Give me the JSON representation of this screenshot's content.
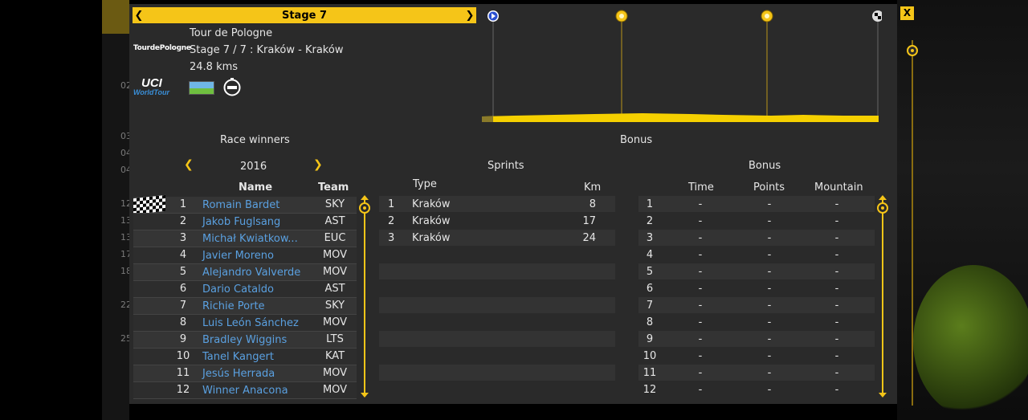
{
  "header": {
    "stage_title": "Stage 7",
    "prev_label": "❮",
    "next_label": "❯",
    "close_label": "X"
  },
  "stage_info": {
    "race_name": "Tour de Pologne",
    "stage_line": "Stage 7 / 7 : Kraków - Kraków",
    "distance": "24.8 kms",
    "race_logo_text": "TourdePologne",
    "category_logo_text": "UCI",
    "category_logo_sub": "WorldTour",
    "flag_colors": [
      "#6fb6e6",
      "#6fbf3f"
    ]
  },
  "profile": {
    "start_icon": "start-flag-icon",
    "sprint_icon": "sprint-point-icon",
    "finish_icon": "finish-flag-icon",
    "accent_color": "#f5c518"
  },
  "race_winners": {
    "title": "Race winners",
    "year": "2016",
    "columns": {
      "name": "Name",
      "team": "Team"
    },
    "rows": [
      {
        "rank": "1",
        "name": "Romain Bardet",
        "team": "SKY"
      },
      {
        "rank": "2",
        "name": "Jakob Fuglsang",
        "team": "AST"
      },
      {
        "rank": "3",
        "name": "Michał Kwiatkow...",
        "team": "EUC"
      },
      {
        "rank": "4",
        "name": "Javier Moreno",
        "team": "MOV"
      },
      {
        "rank": "5",
        "name": "Alejandro Valverde",
        "team": "MOV"
      },
      {
        "rank": "6",
        "name": "Dario Cataldo",
        "team": "AST"
      },
      {
        "rank": "7",
        "name": "Richie Porte",
        "team": "SKY"
      },
      {
        "rank": "8",
        "name": "Luis León Sánchez",
        "team": "MOV"
      },
      {
        "rank": "9",
        "name": "Bradley Wiggins",
        "team": "LTS"
      },
      {
        "rank": "10",
        "name": "Tanel Kangert",
        "team": "KAT"
      },
      {
        "rank": "11",
        "name": "Jesús Herrada",
        "team": "MOV"
      },
      {
        "rank": "12",
        "name": "Winner Anacona",
        "team": "MOV"
      }
    ]
  },
  "bonus_section": {
    "title": "Bonus"
  },
  "sprints": {
    "title": "Sprints",
    "columns": {
      "type": "Type",
      "km": "Km"
    },
    "rows": [
      {
        "idx": "1",
        "type": "Kraków",
        "km": "8"
      },
      {
        "idx": "2",
        "type": "Kraków",
        "km": "17"
      },
      {
        "idx": "3",
        "type": "Kraków",
        "km": "24"
      }
    ]
  },
  "bonus": {
    "title": "Bonus",
    "columns": {
      "time": "Time",
      "points": "Points",
      "mountain": "Mountain"
    },
    "rows": [
      {
        "idx": "1",
        "time": "-",
        "points": "-",
        "mountain": "-"
      },
      {
        "idx": "2",
        "time": "-",
        "points": "-",
        "mountain": "-"
      },
      {
        "idx": "3",
        "time": "-",
        "points": "-",
        "mountain": "-"
      },
      {
        "idx": "4",
        "time": "-",
        "points": "-",
        "mountain": "-"
      },
      {
        "idx": "5",
        "time": "-",
        "points": "-",
        "mountain": "-"
      },
      {
        "idx": "6",
        "time": "-",
        "points": "-",
        "mountain": "-"
      },
      {
        "idx": "7",
        "time": "-",
        "points": "-",
        "mountain": "-"
      },
      {
        "idx": "8",
        "time": "-",
        "points": "-",
        "mountain": "-"
      },
      {
        "idx": "9",
        "time": "-",
        "points": "-",
        "mountain": "-"
      },
      {
        "idx": "10",
        "time": "-",
        "points": "-",
        "mountain": "-"
      },
      {
        "idx": "11",
        "time": "-",
        "points": "-",
        "mountain": "-"
      },
      {
        "idx": "12",
        "time": "-",
        "points": "-",
        "mountain": "-"
      }
    ]
  },
  "background": {
    "left_numbers": [
      "02",
      "03",
      "04",
      "04",
      "12",
      "13",
      "13",
      "17",
      "18",
      "22",
      "25"
    ]
  }
}
